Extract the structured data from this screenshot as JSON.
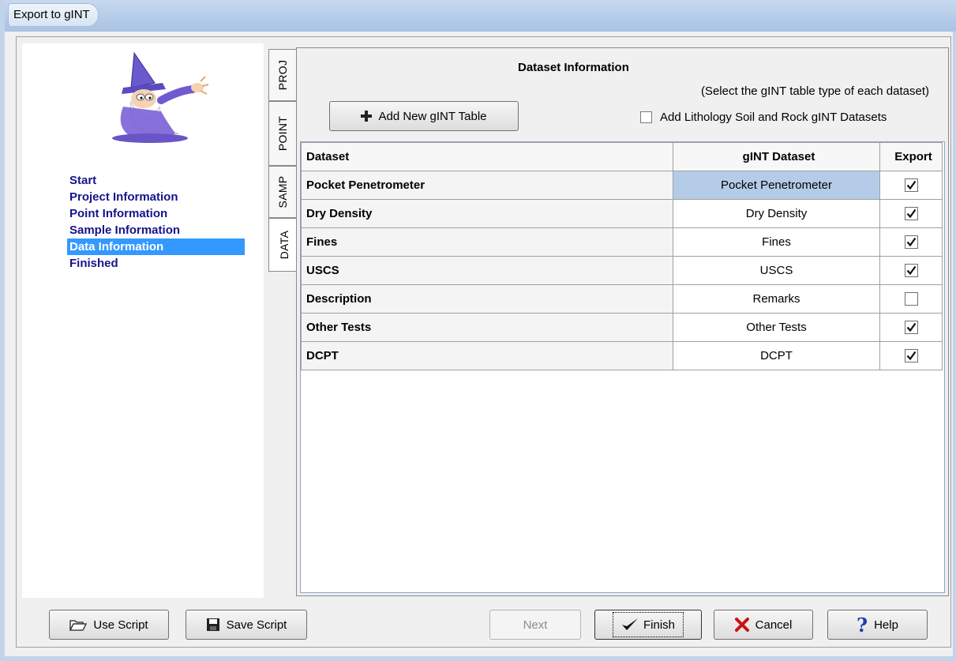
{
  "window": {
    "title": "Export to gINT"
  },
  "steps": [
    {
      "label": "Start",
      "active": false
    },
    {
      "label": "Project Information",
      "active": false
    },
    {
      "label": "Point Information",
      "active": false
    },
    {
      "label": "Sample Information",
      "active": false
    },
    {
      "label": "Data Information",
      "active": true
    },
    {
      "label": "Finished",
      "active": false
    }
  ],
  "tabs": [
    {
      "label": "PROJ"
    },
    {
      "label": "POINT"
    },
    {
      "label": "SAMP"
    },
    {
      "label": "DATA"
    }
  ],
  "dataset_panel": {
    "title": "Dataset Information",
    "hint": "(Select the gINT table type of each dataset)",
    "add_button": "Add New gINT Table",
    "lithology_checkbox": {
      "label": "Add Lithology Soil and Rock gINT Datasets",
      "checked": false
    },
    "columns": [
      "Dataset",
      "gINT Dataset",
      "Export"
    ],
    "rows": [
      {
        "dataset": "Pocket Penetrometer",
        "gint": "Pocket Penetrometer",
        "export": true,
        "selected": true
      },
      {
        "dataset": "Dry Density",
        "gint": "Dry Density",
        "export": true,
        "selected": false
      },
      {
        "dataset": "Fines",
        "gint": "Fines",
        "export": true,
        "selected": false
      },
      {
        "dataset": "USCS",
        "gint": "USCS",
        "export": true,
        "selected": false
      },
      {
        "dataset": "Description",
        "gint": "Remarks",
        "export": false,
        "selected": false
      },
      {
        "dataset": "Other Tests",
        "gint": "Other Tests",
        "export": true,
        "selected": false
      },
      {
        "dataset": "DCPT",
        "gint": "DCPT",
        "export": true,
        "selected": false
      }
    ]
  },
  "buttons": {
    "use_script": "Use Script",
    "save_script": "Save Script",
    "next": "Next",
    "finish": "Finish",
    "cancel": "Cancel",
    "help": "Help"
  },
  "colors": {
    "selection": "#3399ff",
    "selected_cell": "#b4cce8",
    "step_text": "#14148c",
    "cancel_icon": "#cc1111",
    "help_icon": "#1a3fb0"
  },
  "icons": {
    "add": "plus-icon",
    "use_script": "open-folder-icon",
    "save_script": "floppy-disk-icon",
    "finish": "checkmark-icon",
    "cancel": "red-x-icon",
    "help": "question-mark-icon"
  }
}
